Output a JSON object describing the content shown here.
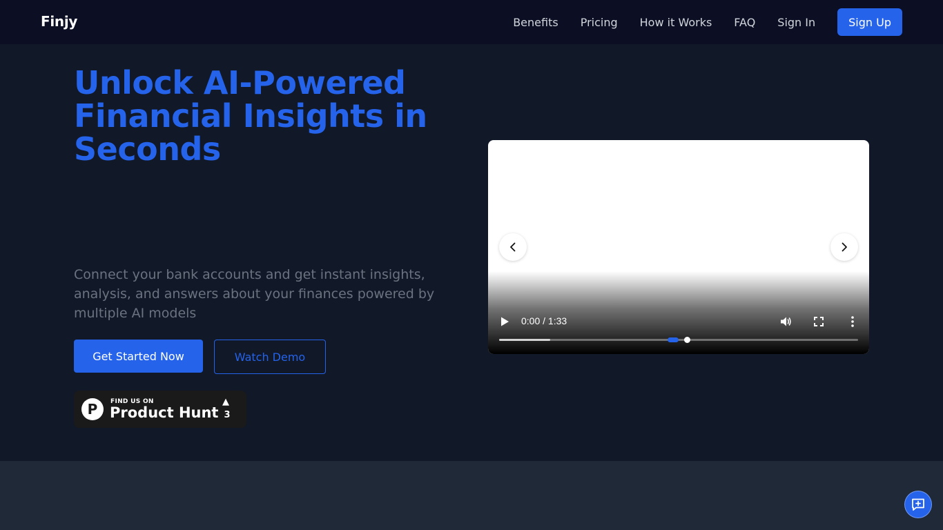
{
  "header": {
    "logo": "Finjy",
    "nav": [
      "Benefits",
      "Pricing",
      "How it Works",
      "FAQ",
      "Sign In"
    ],
    "signup_label": "Sign Up"
  },
  "hero": {
    "title": "Unlock AI-Powered Financial Insights in Seconds",
    "subtitle": "Connect your bank accounts and get instant insights, analysis, and answers about your finances powered by multiple AI models",
    "primary_cta": "Get Started Now",
    "secondary_cta": "Watch Demo"
  },
  "product_hunt": {
    "small_text": "FIND US ON",
    "name": "Product Hunt",
    "upvotes": "3",
    "logo_letter": "P"
  },
  "video": {
    "time": "0:00 / 1:33",
    "playback_position": 0.524,
    "buffered_fraction": 0.142
  },
  "icons": {
    "prev": "chevron-left-icon",
    "next": "chevron-right-icon",
    "play": "play-icon",
    "volume": "volume-icon",
    "fullscreen": "fullscreen-icon",
    "more": "more-vertical-icon",
    "chat": "chat-plus-icon"
  },
  "colors": {
    "accent": "#2563eb",
    "header_bg": "#0c0f24",
    "hero_bg": "#111827",
    "lower_bg": "#1f2937"
  }
}
